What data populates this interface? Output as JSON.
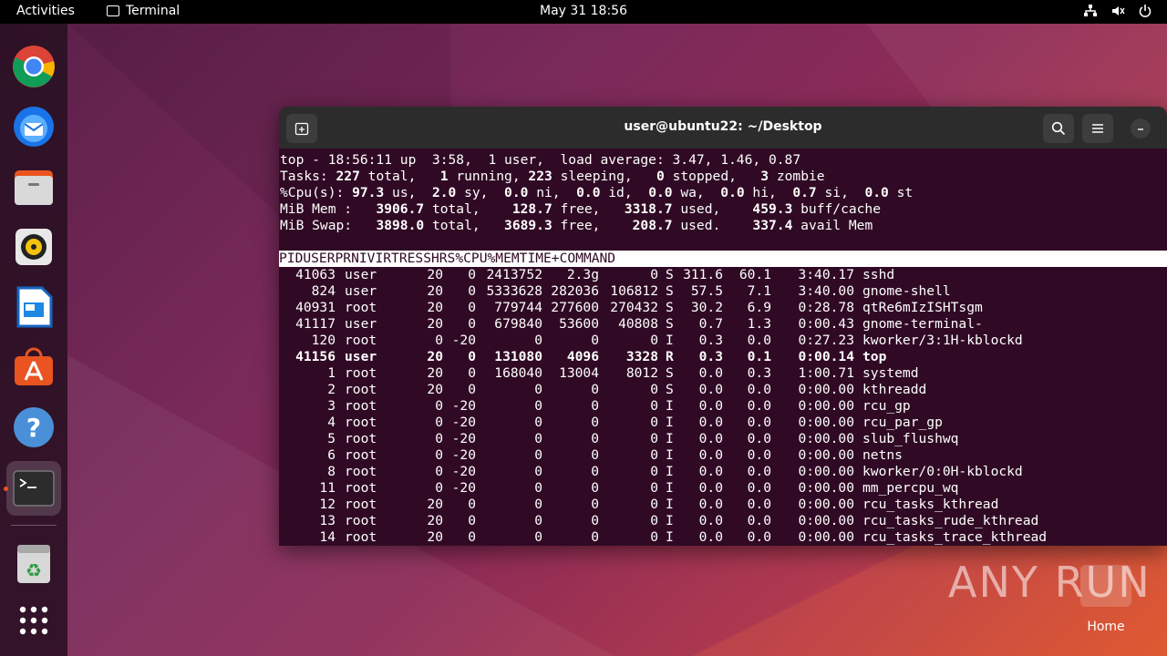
{
  "topbar": {
    "activities": "Activities",
    "app_name": "Terminal",
    "clock": "May 31  18:56",
    "icons": [
      "network-icon",
      "volume-icon",
      "power-icon"
    ]
  },
  "dock": {
    "items": [
      "chrome-icon",
      "thunderbird-icon",
      "files-icon",
      "rhythmbox-icon",
      "libreoffice-writer-icon",
      "app-center-icon",
      "help-icon",
      "terminal-icon",
      "trash-icon",
      "show-apps-icon"
    ]
  },
  "window": {
    "title": "user@ubuntu22: ~/Desktop"
  },
  "top": {
    "line1": "top - 18:56:11 up  3:58,  1 user,  load average: 3.47, 1.46, 0.87",
    "tasks": {
      "label": "Tasks:",
      "total": "227",
      "running": "1",
      "sleeping": "223",
      "stopped": "0",
      "zombie": "3"
    },
    "cpu": {
      "label": "%Cpu(s):",
      "us": "97.3",
      "sy": "2.0",
      "ni": "0.0",
      "id": "0.0",
      "wa": "0.0",
      "hi": "0.0",
      "si": "0.7",
      "st": "0.0"
    },
    "mem": {
      "label": "MiB Mem :",
      "total": "3906.7",
      "free": "128.7",
      "used": "3318.7",
      "buff": "459.3"
    },
    "swap": {
      "label": "MiB Swap:",
      "total": "3898.0",
      "free": "3689.3",
      "used": "208.7",
      "avail": "337.4"
    },
    "columns": [
      "PID",
      "USER",
      "PR",
      "NI",
      "VIRT",
      "RES",
      "SHR",
      "S",
      "%CPU",
      "%MEM",
      "TIME+",
      "COMMAND"
    ],
    "processes": [
      [
        "41063",
        "user",
        "20",
        "0",
        "2413752",
        "2.3g",
        "0",
        "S",
        "311.6",
        "60.1",
        "3:40.17",
        "sshd"
      ],
      [
        "824",
        "user",
        "20",
        "0",
        "5333628",
        "282036",
        "106812",
        "S",
        "57.5",
        "7.1",
        "3:40.00",
        "gnome-shell"
      ],
      [
        "40931",
        "root",
        "20",
        "0",
        "779744",
        "277600",
        "270432",
        "S",
        "30.2",
        "6.9",
        "0:28.78",
        "qtRe6mIzISHTsgm"
      ],
      [
        "41117",
        "user",
        "20",
        "0",
        "679840",
        "53600",
        "40808",
        "S",
        "0.7",
        "1.3",
        "0:00.43",
        "gnome-terminal-"
      ],
      [
        "120",
        "root",
        "0",
        "-20",
        "0",
        "0",
        "0",
        "I",
        "0.3",
        "0.0",
        "0:27.23",
        "kworker/3:1H-kblockd"
      ],
      [
        "41156",
        "user",
        "20",
        "0",
        "131080",
        "4096",
        "3328",
        "R",
        "0.3",
        "0.1",
        "0:00.14",
        "top"
      ],
      [
        "1",
        "root",
        "20",
        "0",
        "168040",
        "13004",
        "8012",
        "S",
        "0.0",
        "0.3",
        "1:00.71",
        "systemd"
      ],
      [
        "2",
        "root",
        "20",
        "0",
        "0",
        "0",
        "0",
        "S",
        "0.0",
        "0.0",
        "0:00.00",
        "kthreadd"
      ],
      [
        "3",
        "root",
        "0",
        "-20",
        "0",
        "0",
        "0",
        "I",
        "0.0",
        "0.0",
        "0:00.00",
        "rcu_gp"
      ],
      [
        "4",
        "root",
        "0",
        "-20",
        "0",
        "0",
        "0",
        "I",
        "0.0",
        "0.0",
        "0:00.00",
        "rcu_par_gp"
      ],
      [
        "5",
        "root",
        "0",
        "-20",
        "0",
        "0",
        "0",
        "I",
        "0.0",
        "0.0",
        "0:00.00",
        "slub_flushwq"
      ],
      [
        "6",
        "root",
        "0",
        "-20",
        "0",
        "0",
        "0",
        "I",
        "0.0",
        "0.0",
        "0:00.00",
        "netns"
      ],
      [
        "8",
        "root",
        "0",
        "-20",
        "0",
        "0",
        "0",
        "I",
        "0.0",
        "0.0",
        "0:00.00",
        "kworker/0:0H-kblockd"
      ],
      [
        "11",
        "root",
        "0",
        "-20",
        "0",
        "0",
        "0",
        "I",
        "0.0",
        "0.0",
        "0:00.00",
        "mm_percpu_wq"
      ],
      [
        "12",
        "root",
        "20",
        "0",
        "0",
        "0",
        "0",
        "I",
        "0.0",
        "0.0",
        "0:00.00",
        "rcu_tasks_kthread"
      ],
      [
        "13",
        "root",
        "20",
        "0",
        "0",
        "0",
        "0",
        "I",
        "0.0",
        "0.0",
        "0:00.00",
        "rcu_tasks_rude_kthread"
      ],
      [
        "14",
        "root",
        "20",
        "0",
        "0",
        "0",
        "0",
        "I",
        "0.0",
        "0.0",
        "0:00.00",
        "rcu_tasks_trace_kthread"
      ]
    ],
    "bold_row": 5
  },
  "desktop": {
    "watermark": "ANY RUN",
    "home_label": "Home"
  }
}
